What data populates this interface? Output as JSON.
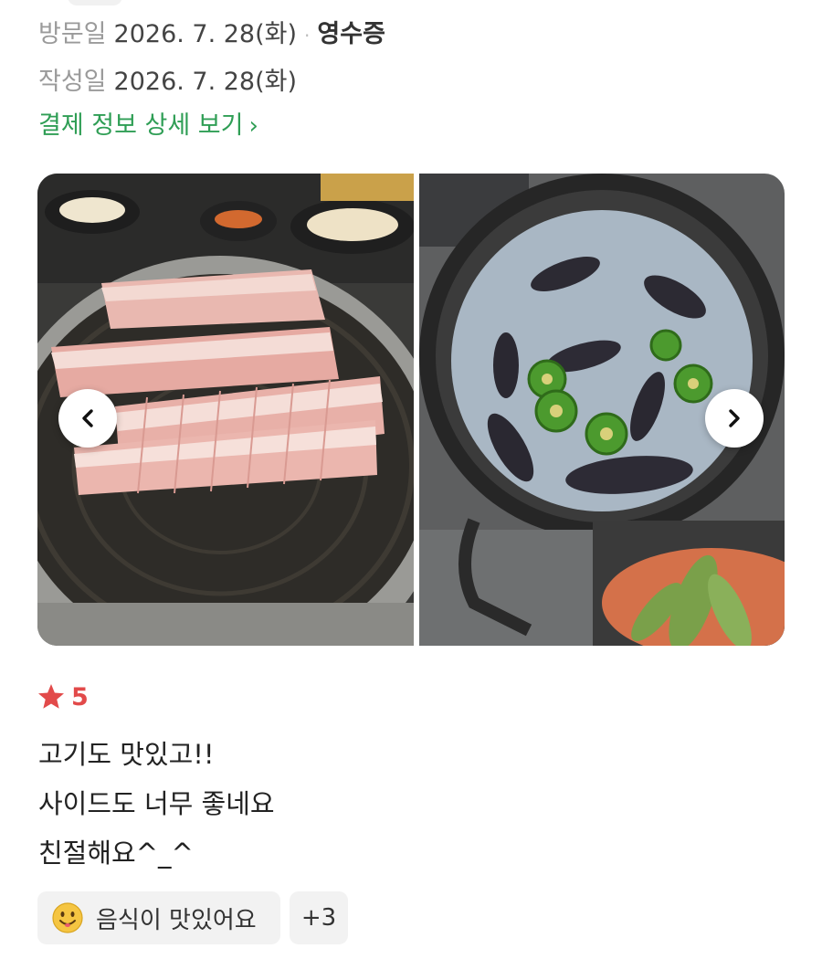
{
  "visit": {
    "label": "방문일",
    "date": "2026. 7. 28(화)",
    "separator": "·",
    "receipt_label": "영수증"
  },
  "written": {
    "label": "작성일",
    "date": "2026. 7. 28(화)"
  },
  "payment_detail_link": "결제 정보 상세 보기",
  "photos": [
    {
      "subject": "grilled pork belly"
    },
    {
      "subject": "mussel soup"
    }
  ],
  "rating": {
    "value": "5",
    "star_color": "#e24a4a"
  },
  "review_lines": [
    "고기도 맛있고!!",
    "사이드도 너무 좋네요",
    "친절해요^_^"
  ],
  "tags": {
    "first": {
      "icon": "smiley-icon",
      "label": "음식이 맛있어요"
    },
    "more": "+3"
  },
  "colors": {
    "link_green": "#2f9e55",
    "meta_gray": "#9a9a9a",
    "chip_bg": "#f2f2f2"
  }
}
